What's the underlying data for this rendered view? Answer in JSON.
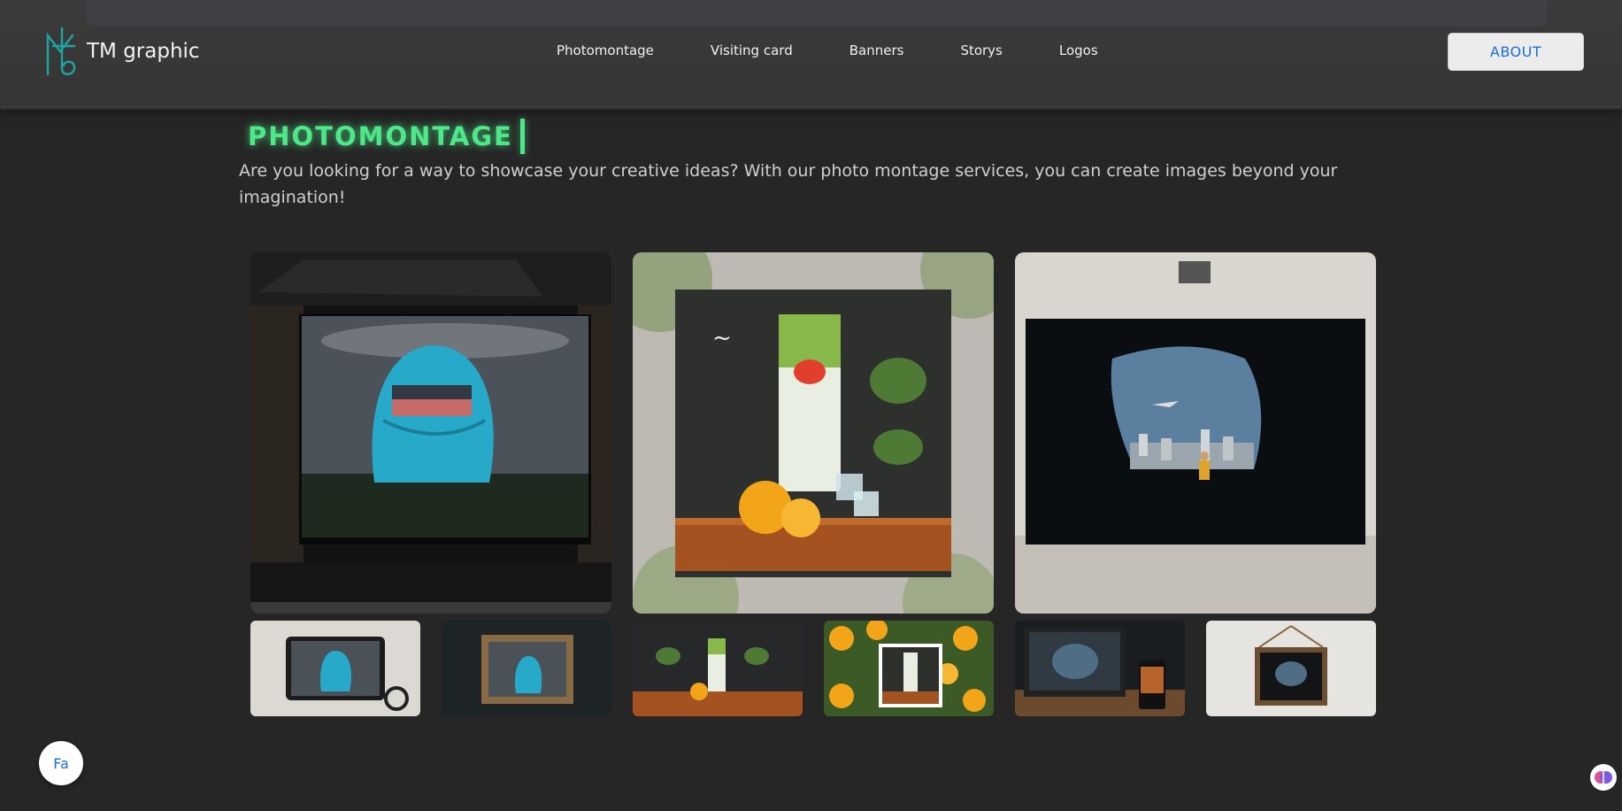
{
  "header": {
    "brand": "TM graphic",
    "nav": [
      "Photomontage",
      "Visiting card",
      "Banners",
      "Storys",
      "Logos"
    ],
    "about_label": "ABOUT"
  },
  "section": {
    "title": "PHOTOMONTAGE",
    "intro": "Are you looking for a way to showcase your creative ideas? With our photo montage services, you can create images beyond your imagination!"
  },
  "gallery": {
    "main": [
      {
        "subject": "blue backpack in shop window"
      },
      {
        "subject": "orange juice carton ad"
      },
      {
        "subject": "cave overlooking city with airplane"
      }
    ],
    "thumbs": [
      {
        "subject": "tablet with backpack"
      },
      {
        "subject": "framed backpack"
      },
      {
        "subject": "juice ad on dark wall"
      },
      {
        "subject": "juice ad frame on oranges"
      },
      {
        "subject": "laptop with cave image"
      },
      {
        "subject": "hanging frame with cave"
      }
    ]
  },
  "lang_label": "Fa",
  "colors": {
    "accent_green": "#4ee78a",
    "link_blue": "#1a6fd6",
    "background": "#262626",
    "logo_teal": "#1fa3a0"
  },
  "icons": [
    "logo-icon",
    "brain-icon"
  ]
}
